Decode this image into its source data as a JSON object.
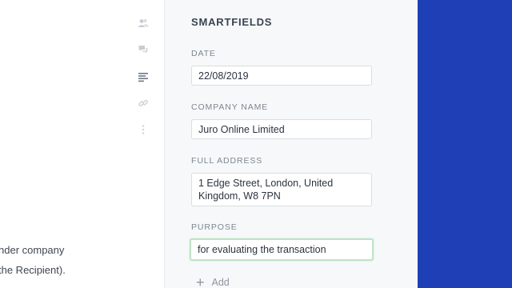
{
  "document": {
    "lines": [
      "nder company",
      "the Recipient)."
    ]
  },
  "toolbar": {
    "icons": [
      "users-icon",
      "chat-icon",
      "align-left-icon",
      "link-icon",
      "more-vertical-icon"
    ]
  },
  "smartfields": {
    "title": "SMARTFIELDS",
    "date": {
      "label": "DATE",
      "value": "22/08/2019"
    },
    "company": {
      "label": "COMPANY NAME",
      "value": "Juro Online Limited"
    },
    "address": {
      "label": "FULL ADDRESS",
      "value": "1 Edge Street, London, United Kingdom, W8 7PN"
    },
    "purpose": {
      "label": "PURPOSE",
      "value": "for evaluating the transaction"
    },
    "add_label": "Add"
  },
  "colors": {
    "accent_blue": "#1f3fb6",
    "focus_green": "#bfe3c9"
  }
}
